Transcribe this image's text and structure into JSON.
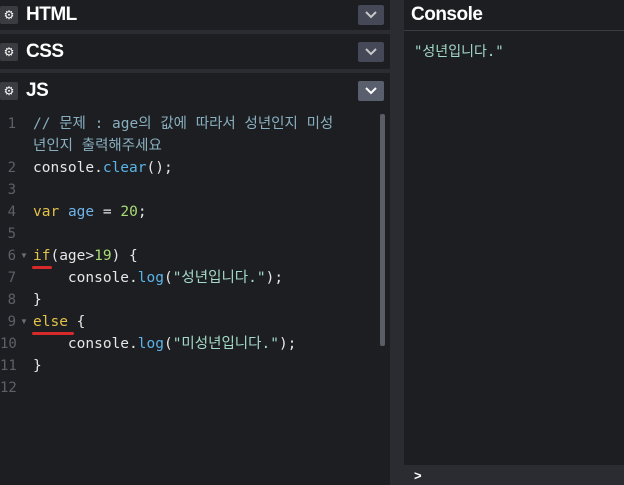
{
  "editors": {
    "html": {
      "title": "HTML"
    },
    "css": {
      "title": "CSS"
    },
    "js": {
      "title": "JS"
    }
  },
  "code_lines": [
    {
      "n": "1",
      "text": "// 문제 : age의 값에 따라서 성년인지 미성"
    },
    {
      "n": "",
      "text": "년인지 출력해주세요"
    },
    {
      "n": "2",
      "text": "console.clear();"
    },
    {
      "n": "3",
      "text": ""
    },
    {
      "n": "4",
      "text": "var age = 20;"
    },
    {
      "n": "5",
      "text": ""
    },
    {
      "n": "6",
      "text": "if(age>19) {"
    },
    {
      "n": "7",
      "text": "    console.log(\"성년입니다.\");"
    },
    {
      "n": "8",
      "text": "}"
    },
    {
      "n": "9",
      "text": "else {"
    },
    {
      "n": "10",
      "text": "    console.log(\"미성년입니다.\");"
    },
    {
      "n": "11",
      "text": "}"
    },
    {
      "n": "12",
      "text": ""
    }
  ],
  "console": {
    "title": "Console",
    "output": "\"성년입니다.\"",
    "prompt": ">"
  },
  "icons": {
    "settings": "gear-icon",
    "collapse": "chevron-down-icon"
  }
}
